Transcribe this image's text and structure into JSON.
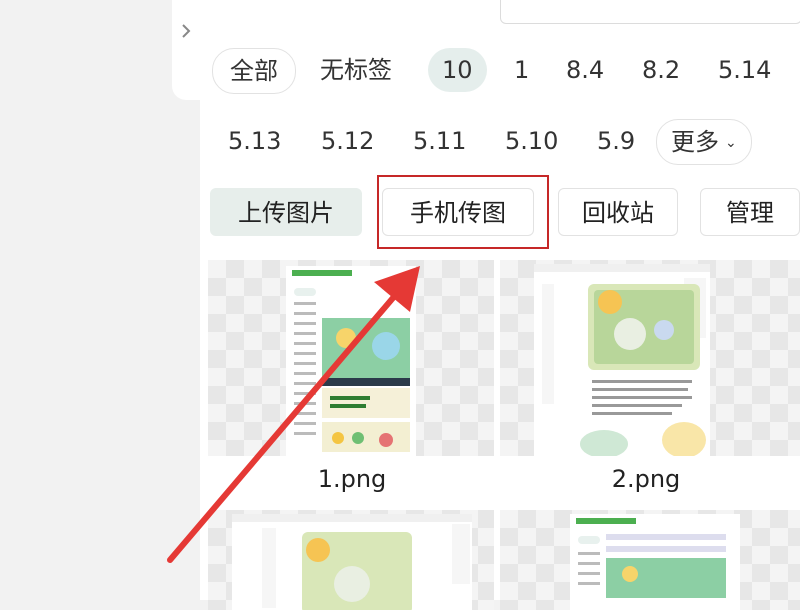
{
  "tags": {
    "all": "全部",
    "untagged": "无标签",
    "selected": "10",
    "row1": [
      "1",
      "8.4",
      "8.2",
      "5.14"
    ],
    "row2": [
      "5.13",
      "5.12",
      "5.11",
      "5.10",
      "5.9"
    ],
    "more": "更多"
  },
  "actions": {
    "upload": "上传图片",
    "phone_upload": "手机传图",
    "recycle": "回收站",
    "manage": "管理"
  },
  "images": [
    {
      "name": "1.png"
    },
    {
      "name": "2.png"
    }
  ],
  "colors": {
    "highlight": "#c62828",
    "arrow": "#e53935",
    "active_tag_bg": "#e5eeec"
  }
}
